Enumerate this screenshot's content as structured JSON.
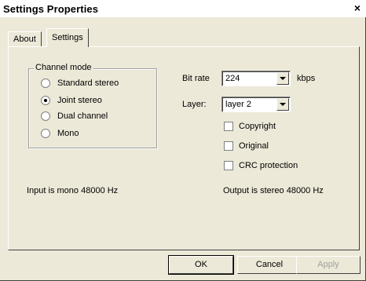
{
  "window": {
    "title": "Settings Properties",
    "close_label": "×"
  },
  "tabs": [
    {
      "label": "About",
      "selected": false
    },
    {
      "label": "Settings",
      "selected": true
    }
  ],
  "channel_mode": {
    "label": "Channel mode",
    "options": [
      {
        "label": "Standard stereo",
        "checked": false
      },
      {
        "label": "Joint stereo",
        "checked": true
      },
      {
        "label": "Dual channel",
        "checked": false
      },
      {
        "label": "Mono",
        "checked": false
      }
    ]
  },
  "bitrate": {
    "label": "Bit rate",
    "value": "224",
    "unit": "kbps"
  },
  "layer": {
    "label": "Layer:",
    "value": "layer 2"
  },
  "checkboxes": [
    {
      "label": "Copyright",
      "checked": false
    },
    {
      "label": "Original",
      "checked": false
    },
    {
      "label": "CRC protection",
      "checked": false
    }
  ],
  "status": {
    "input": "Input is mono 48000 Hz",
    "output": "Output is stereo 48000 Hz"
  },
  "buttons": {
    "ok": "OK",
    "cancel": "Cancel",
    "apply": "Apply"
  }
}
